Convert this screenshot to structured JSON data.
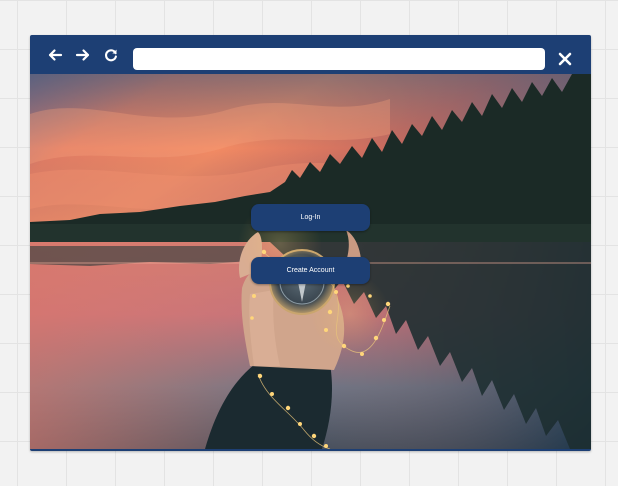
{
  "toolbar": {
    "back_icon": "arrow-left-icon",
    "forward_icon": "arrow-right-icon",
    "reload_icon": "reload-icon",
    "close_icon": "close-icon",
    "address": {
      "value": "",
      "placeholder": ""
    }
  },
  "hero": {
    "image": "sunset-lake-hand-holding-compass-with-fairy-lights"
  },
  "auth": {
    "login_label": "Log-In",
    "create_account_label": "Create Account"
  },
  "colors": {
    "brand": "#1d3f74",
    "canvas": "#f2f2f2",
    "button_text": "#ffffff"
  }
}
